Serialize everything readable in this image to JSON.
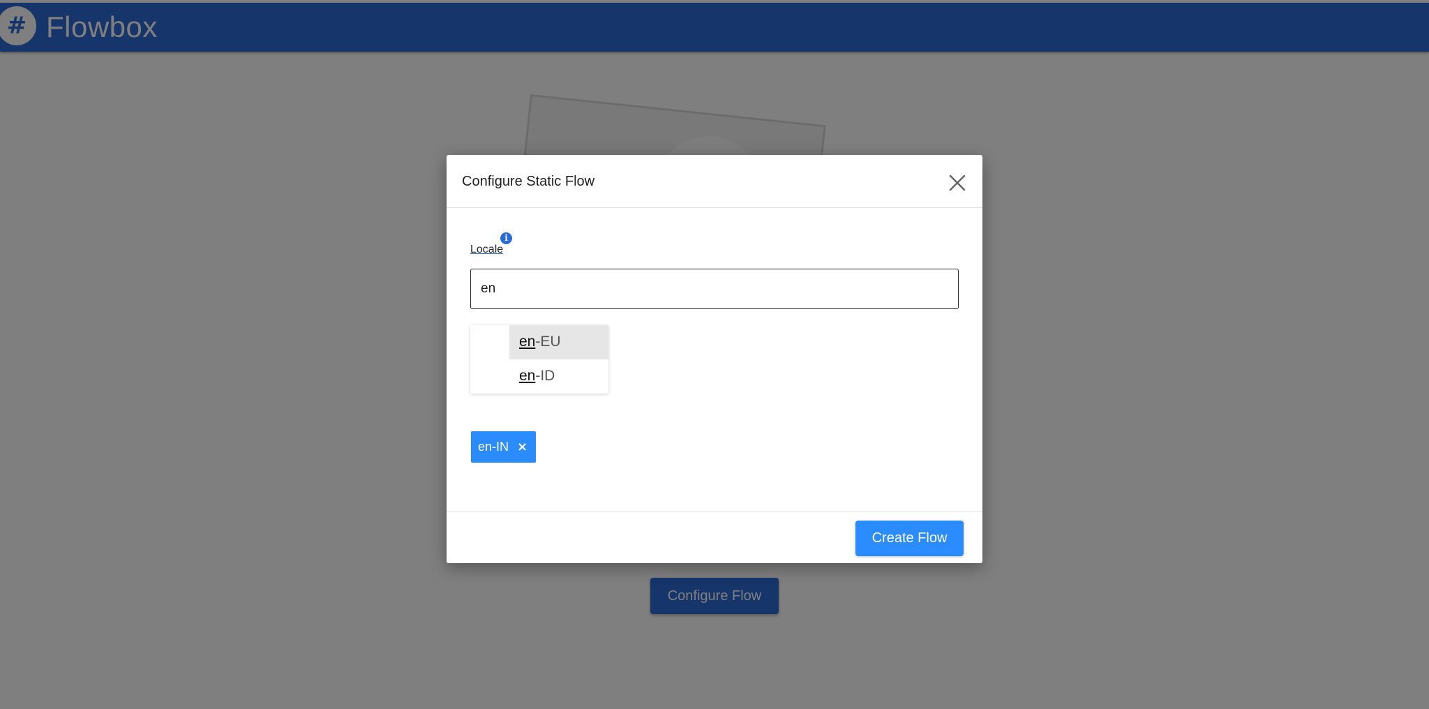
{
  "app": {
    "brand_logo_glyph": "#",
    "brand_name": "Flowbox",
    "header_color": "#2b6bd6"
  },
  "background": {
    "configure_button_label": "Configure Flow"
  },
  "modal": {
    "title": "Configure Static Flow",
    "close_icon": "close-icon",
    "locale_label": "Locale",
    "info_icon_glyph": "i",
    "locale_input_value": "en",
    "dropdown_options": [
      {
        "match": "en",
        "rest": "-EU",
        "highlighted": true
      },
      {
        "match": "en",
        "rest": "-ID",
        "highlighted": false
      }
    ],
    "selected_tags": [
      {
        "label": "en-IN",
        "remove_glyph": "×"
      }
    ],
    "create_button_label": "Create Flow",
    "accent_color": "#2b8cff"
  }
}
